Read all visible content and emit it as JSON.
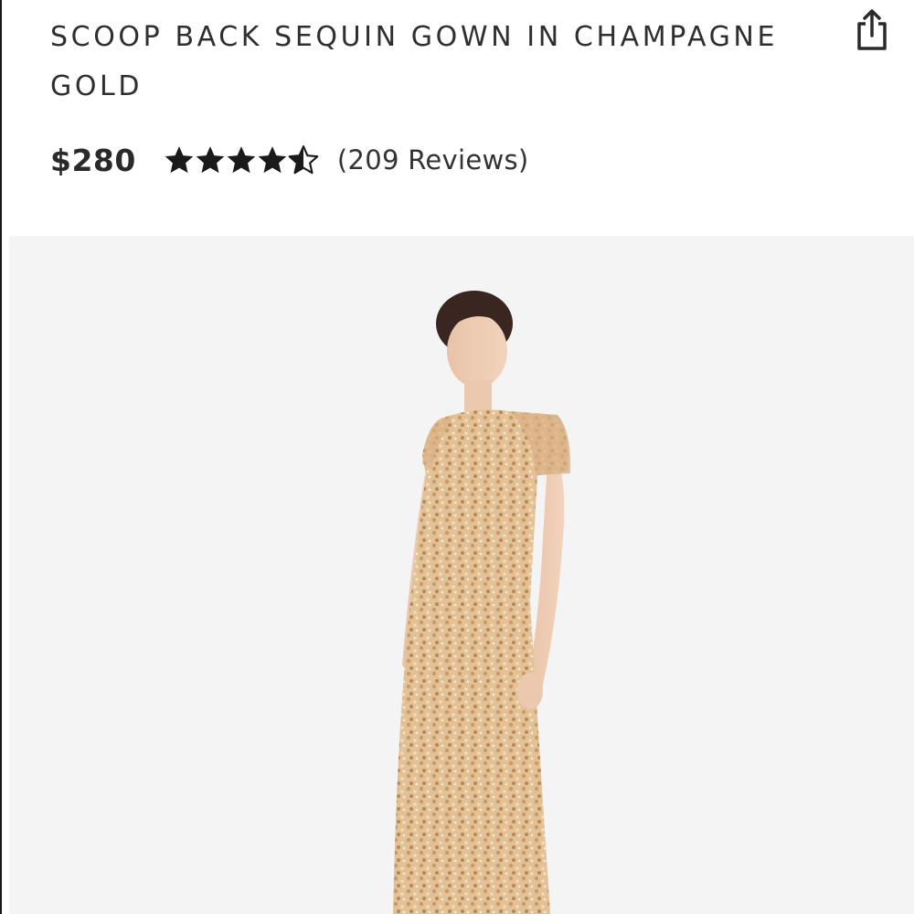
{
  "product": {
    "title": "SCOOP BACK SEQUIN GOWN IN CHAMPAGNE GOLD",
    "price": "$280",
    "rating": 4.5,
    "rating_max": 5,
    "reviews_label": "(209 Reviews)"
  },
  "icons": {
    "share": "share-icon",
    "star_full": "star-icon",
    "star_half": "star-half-icon"
  },
  "colors": {
    "text": "#2f2f2f",
    "star": "#1a1a1a",
    "image_background": "#f4f4f4",
    "gown": "#e2bf95"
  }
}
